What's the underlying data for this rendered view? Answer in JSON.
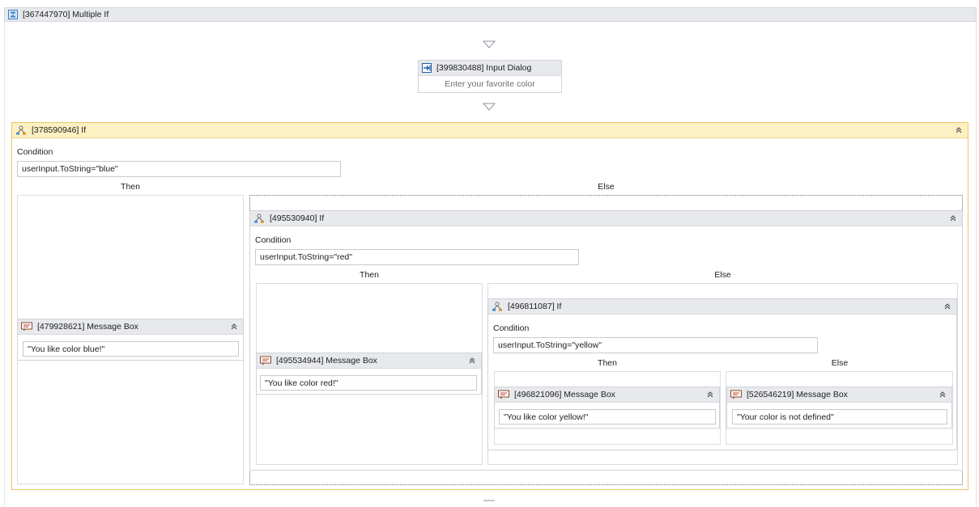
{
  "root": {
    "title": "[367447970] Multiple If"
  },
  "input_dialog": {
    "title": "[399830488] Input Dialog",
    "placeholder": "Enter your favorite color"
  },
  "if1": {
    "title": "[378590946] If",
    "condition_label": "Condition",
    "condition": "userInput.ToString=\"blue\"",
    "then_label": "Then",
    "else_label": "Else",
    "then_msg": {
      "title": "[479928621] Message Box",
      "text": "\"You like color blue!\""
    }
  },
  "if2": {
    "title": "[495530940] If",
    "condition_label": "Condition",
    "condition": "userInput.ToString=\"red\"",
    "then_label": "Then",
    "else_label": "Else",
    "then_msg": {
      "title": "[495534944] Message Box",
      "text": "\"You like color red!\""
    }
  },
  "if3": {
    "title": "[496811087] If",
    "condition_label": "Condition",
    "condition": "userInput.ToString=\"yellow\"",
    "then_label": "Then",
    "else_label": "Else",
    "then_msg": {
      "title": "[496821096] Message Box",
      "text": "\"You like color yellow!\""
    },
    "else_msg": {
      "title": "[526546219] Message Box",
      "text": "\"Your color is not defined\""
    }
  },
  "icons": {
    "root": "sequence-icon",
    "dialog": "input-dialog-icon",
    "if": "if-branch-icon",
    "message": "message-box-icon",
    "collapse": "collapse-chevron-icon",
    "arrow": "drop-arrow-icon"
  },
  "colors": {
    "if_header": "#fdf0c3",
    "if_border": "#e7c767",
    "header_gray": "#e7e9ec"
  }
}
